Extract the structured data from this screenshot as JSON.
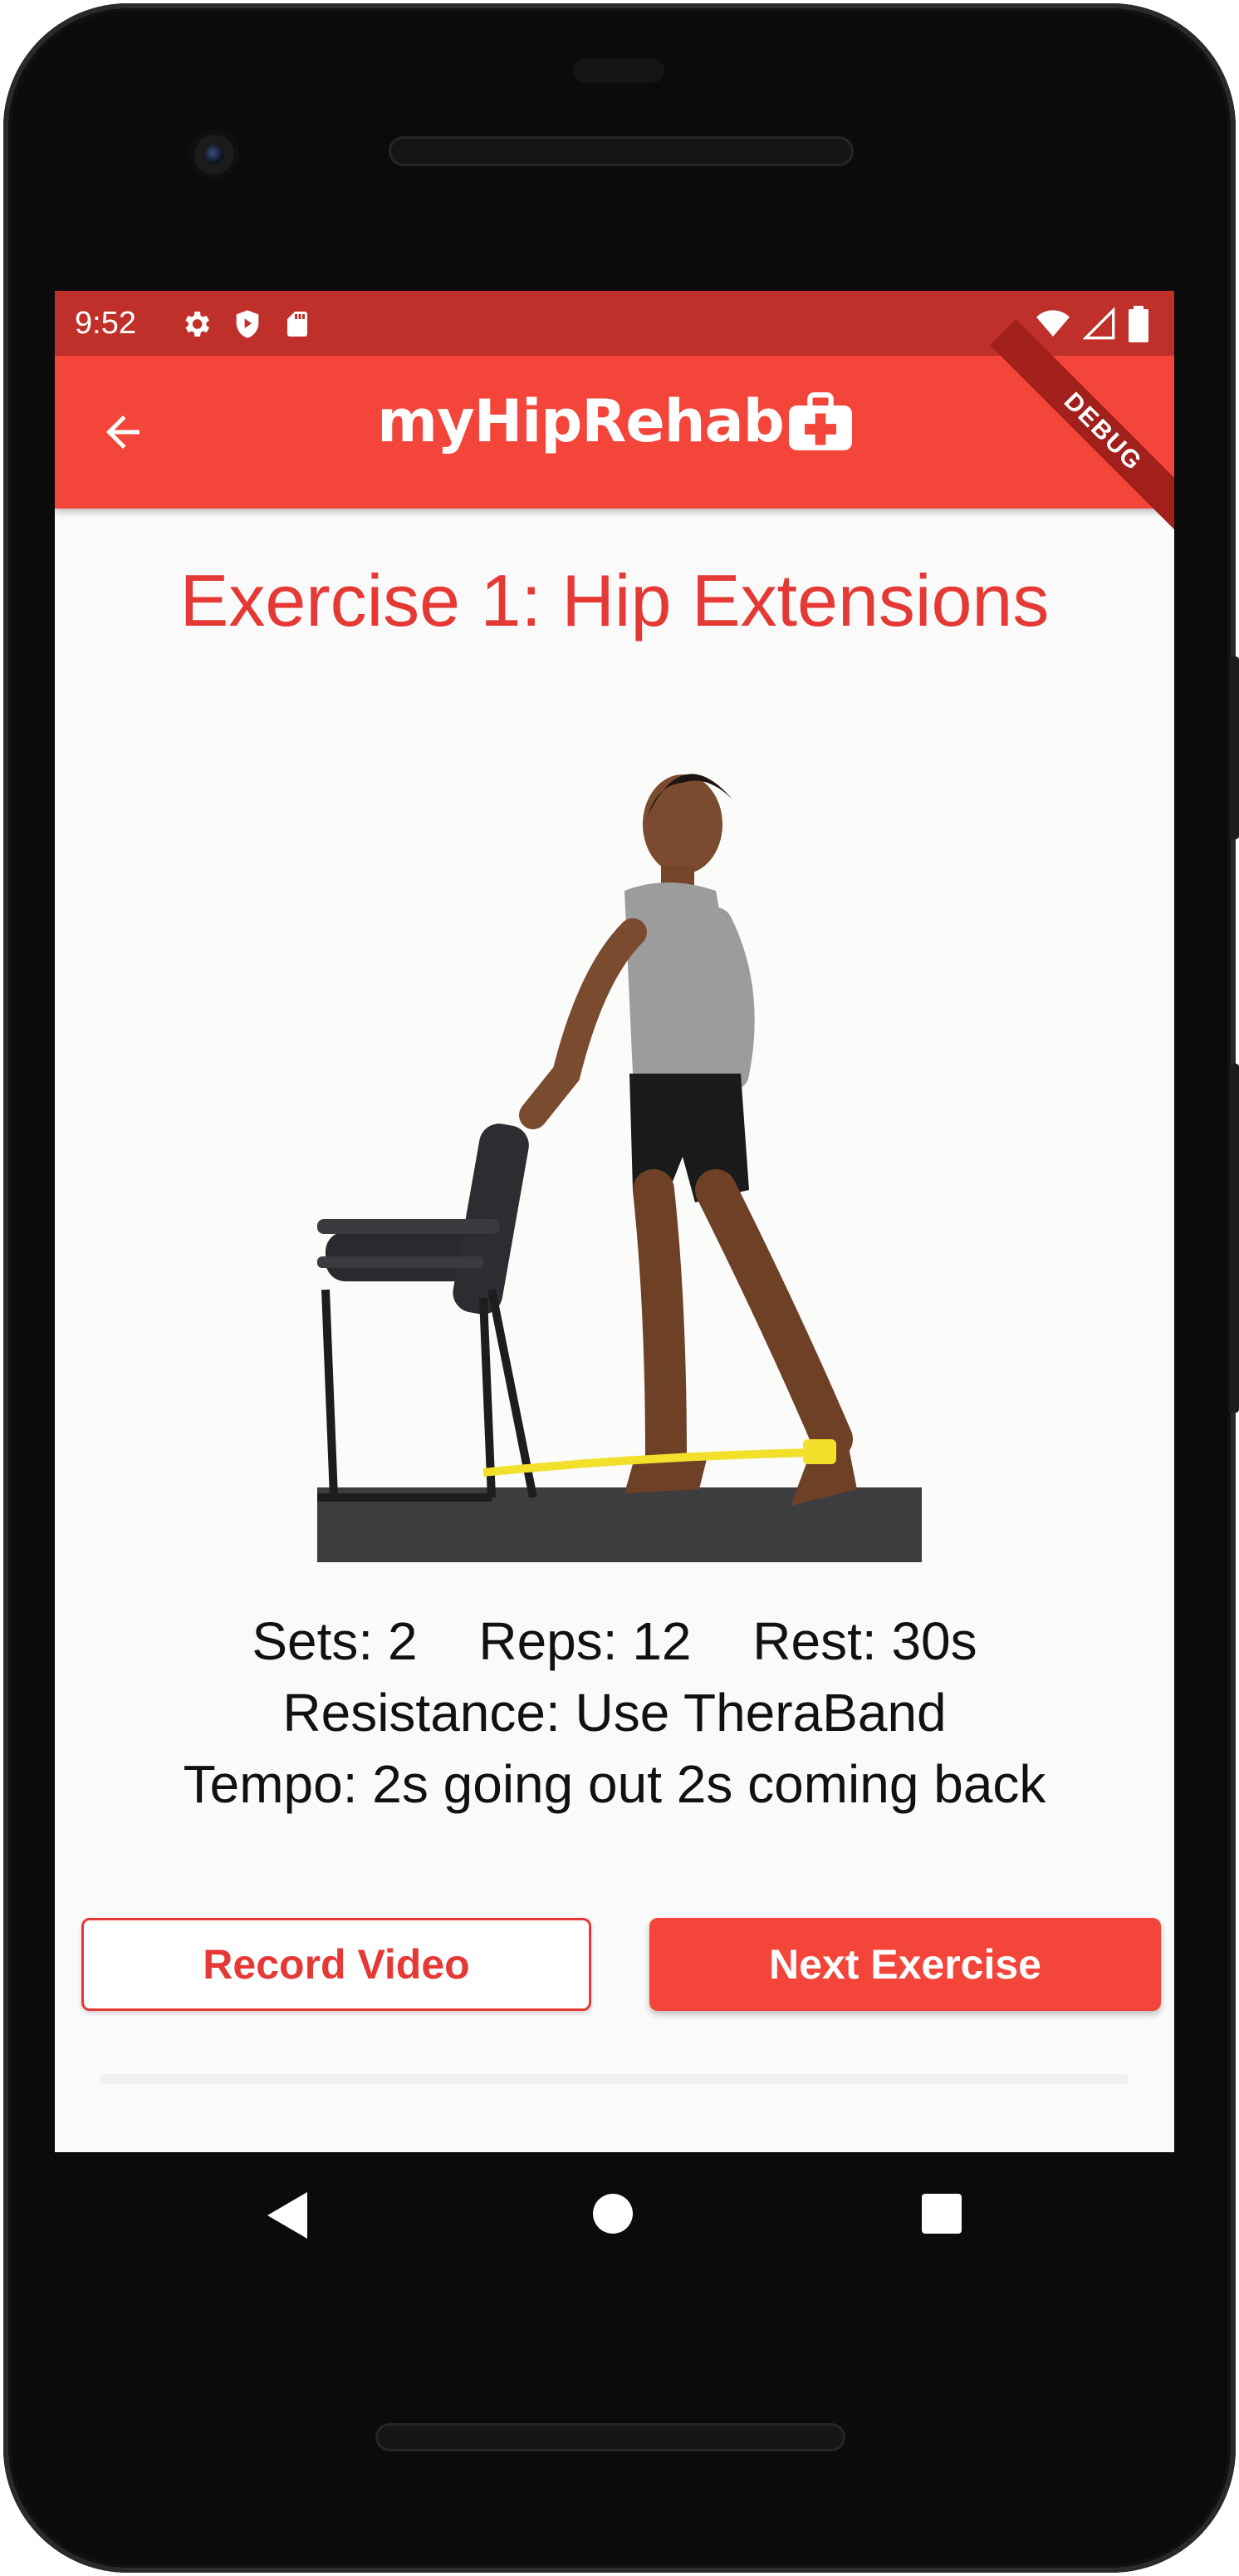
{
  "status_bar": {
    "time": "9:52",
    "debug_label": "DEBUG"
  },
  "app_bar": {
    "brand": "myHipRehab",
    "back_icon": "arrow-back-icon",
    "brand_icon": "medical-kit-icon"
  },
  "exercise": {
    "title": "Exercise 1: Hip Extensions",
    "image_alt": "Man standing holding a chair back with a yellow resistance band around ankles, extending one leg backward",
    "sets": "Sets: 2",
    "reps": "Reps: 12",
    "rest": "Rest: 30s",
    "resistance": "Resistance: Use TheraBand",
    "tempo": "Tempo: 2s going out 2s coming back"
  },
  "buttons": {
    "record_video": "Record Video",
    "next_exercise": "Next Exercise"
  },
  "colors": {
    "primary": "#f3453a",
    "primary_dark": "#c0302b",
    "title_red": "#e53935",
    "screen_bg": "#fafafa"
  },
  "nav_bar": {
    "back": "nav-back-icon",
    "home": "nav-home-icon",
    "recents": "nav-recents-icon"
  }
}
